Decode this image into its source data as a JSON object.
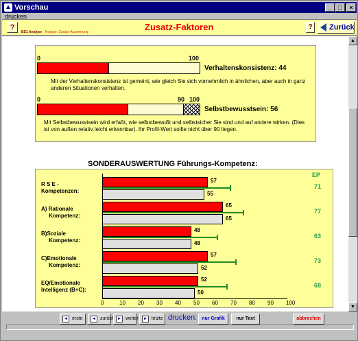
{
  "window": {
    "title": "Vorschau"
  },
  "menu": {
    "print": "drucken"
  },
  "toolbar": {
    "help": "?",
    "sub1": "BS1 Analyse",
    "sub2": "Analyse: Zusatz-Auswertung",
    "heading": "Zusatz-Faktoren",
    "help2": "?",
    "back": "Zurück"
  },
  "traits": [
    {
      "scale_min": "0",
      "scale_max": "100",
      "label": "Verhaltenskonsistenz: 44",
      "value": 44,
      "desc": "Mit der Verhaltenskonsistenz ist gemeint, wie gleich Sie sich vornehmlich in ähnlichen, aber auch in ganz anderen Situationen verhalten."
    },
    {
      "scale_min": "0",
      "scale_mid": "90",
      "scale_max": "100",
      "label": "Selbstbewusstsein: 56",
      "value": 56,
      "hatch_from": 90,
      "desc": "Mit Selbstbewusstsein wird erfaßt, wie selbstbewußt und selbstsicher Sie sind und auf andere wirken. (Dies ist von außen relativ leicht erkennbar). Ihr Profil-Wert sollte nicht über 90 liegen."
    }
  ],
  "section_title": "SONDERAUSWERTUNG Führungs-Kompetenz:",
  "chart_data": {
    "type": "bar",
    "ep_header": "EP",
    "categories": [
      [
        "R S E -",
        "Kompetenzen:"
      ],
      [
        "A) Rationale",
        "     Kompetenz:"
      ],
      [
        "B)Soziale",
        "     Kompetenz:"
      ],
      [
        "C)Emotionale",
        "     Kompetenz:"
      ],
      [
        "EQ/Emotionale",
        "Intelligenz (B+C):"
      ]
    ],
    "series": [
      {
        "values": [
          57,
          65,
          48,
          57,
          52
        ],
        "color": "#ff0000"
      },
      {
        "values": [
          55,
          65,
          48,
          52,
          50
        ],
        "color": "#e0e0e0"
      }
    ],
    "ep_marker_values": [
      69,
      76,
      62,
      72,
      67
    ],
    "ep": [
      "71",
      "77",
      "63",
      "73",
      "68"
    ],
    "xticks": [
      "0",
      "10",
      "20",
      "30",
      "40",
      "50",
      "60",
      "70",
      "80",
      "90",
      "100"
    ],
    "xlim": [
      0,
      100
    ]
  },
  "bottom": {
    "first": "erste",
    "prev": "zurück",
    "next": "weiter",
    "last": "letzte",
    "print": "drucken:",
    "graphic": "nur Grafik",
    "text": "nur Text",
    "cancel": "abbrechen"
  }
}
